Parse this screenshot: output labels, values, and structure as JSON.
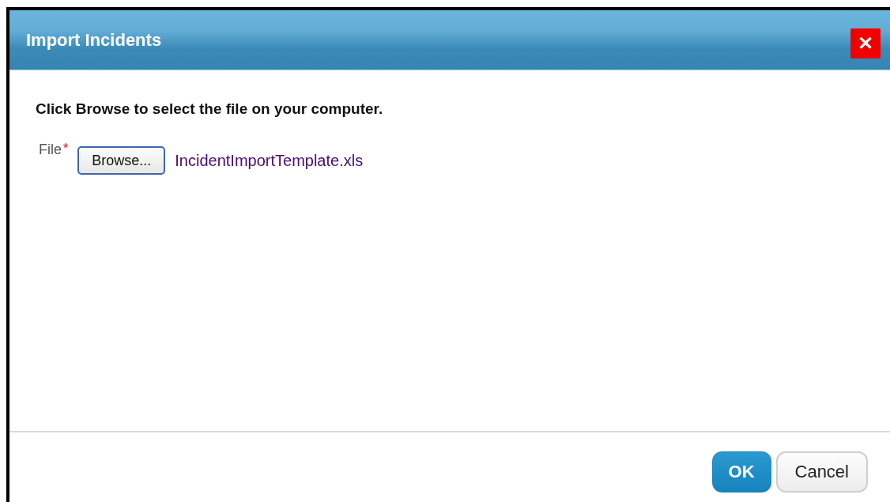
{
  "dialog": {
    "title": "Import Incidents",
    "close_label": "✕"
  },
  "instruction": "Click Browse to select the file on your computer.",
  "file_field": {
    "label": "File",
    "required_mark": "*",
    "button": "Browse...",
    "value": "IncidentImportTemplate.xls"
  },
  "buttons": [
    {
      "label": "OK",
      "kind": "primary"
    },
    {
      "label": "Cancel",
      "kind": "secondary"
    }
  ]
}
